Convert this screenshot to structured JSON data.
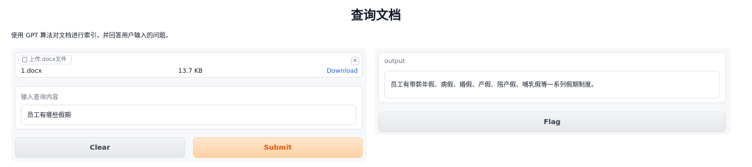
{
  "page": {
    "title": "查询文档",
    "description": "使用 GPT 算法对文档进行索引，并回答用户输入的问题。"
  },
  "upload": {
    "label": "上传.docx文件",
    "file_name": "1.docx",
    "file_size": "13.7 KB",
    "download_label": "Download",
    "close_symbol": "✕"
  },
  "query": {
    "label": "输入查询内容",
    "value": "员工有哪些假期"
  },
  "buttons": {
    "clear": "Clear",
    "submit": "Submit",
    "flag": "Flag"
  },
  "output": {
    "label": "output",
    "value": "员工有带薪年假、病假、婚假、产假、陪产假、哺乳假等一系列假期制度。"
  }
}
